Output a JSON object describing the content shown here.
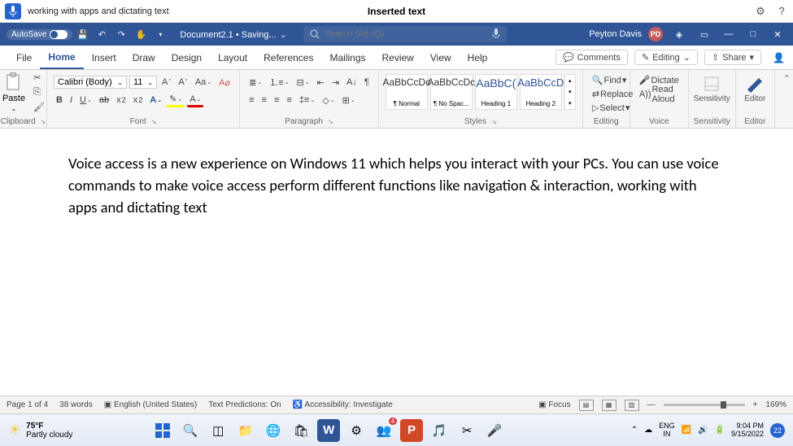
{
  "voice": {
    "text": "working with apps and dictating text",
    "center": "Inserted text"
  },
  "titlebar": {
    "autosave": "AutoSave",
    "doc": "Document2.1 • Saving...",
    "search_placeholder": "Search (Alt+Q)",
    "user": "Peyton Davis",
    "initials": "PD"
  },
  "tabs": {
    "items": [
      "File",
      "Home",
      "Insert",
      "Draw",
      "Design",
      "Layout",
      "References",
      "Mailings",
      "Review",
      "View",
      "Help"
    ],
    "active": 1,
    "comments": "Comments",
    "editing": "Editing",
    "share": "Share"
  },
  "ribbon": {
    "paste": "Paste",
    "clipboard": "Clipboard",
    "font_name": "Calibri (Body)",
    "font_size": "11",
    "font": "Font",
    "paragraph": "Paragraph",
    "styles": "Styles",
    "editing": "Editing",
    "voice": "Voice",
    "sensitivity": "Sensitivity",
    "editor": "Editor",
    "style_sample": "AaBbCcDc",
    "style_normal": "¶ Normal",
    "style_nospace": "¶ No Spac...",
    "style_h1": "Heading 1",
    "style_h2": "Heading 2",
    "style_h1_sample": "AaBbC(",
    "style_h2_sample": "AaBbCcD",
    "find": "Find",
    "replace": "Replace",
    "select": "Select",
    "dictate": "Dictate",
    "read_aloud": "Read Aloud",
    "sensitivity_b": "Sensitivity",
    "editor_b": "Editor",
    "aa": "Aa"
  },
  "document": {
    "body": "Voice access is a new experience on Windows 11 which helps you interact with your PCs. You can use voice commands to make voice access perform different functions like navigation & interaction, working with apps and dictating text"
  },
  "status": {
    "page": "Page 1 of 4",
    "words": "38 words",
    "lang": "English (United States)",
    "pred": "Text Predictions: On",
    "access": "Accessibility: Investigate",
    "focus": "Focus",
    "zoom": "169%"
  },
  "taskbar": {
    "temp": "75°F",
    "cond": "Partly cloudy",
    "lang1": "ENG",
    "lang2": "IN",
    "time": "9:04 PM",
    "date": "9/15/2022",
    "teams_badge": "4",
    "notif": "22"
  }
}
